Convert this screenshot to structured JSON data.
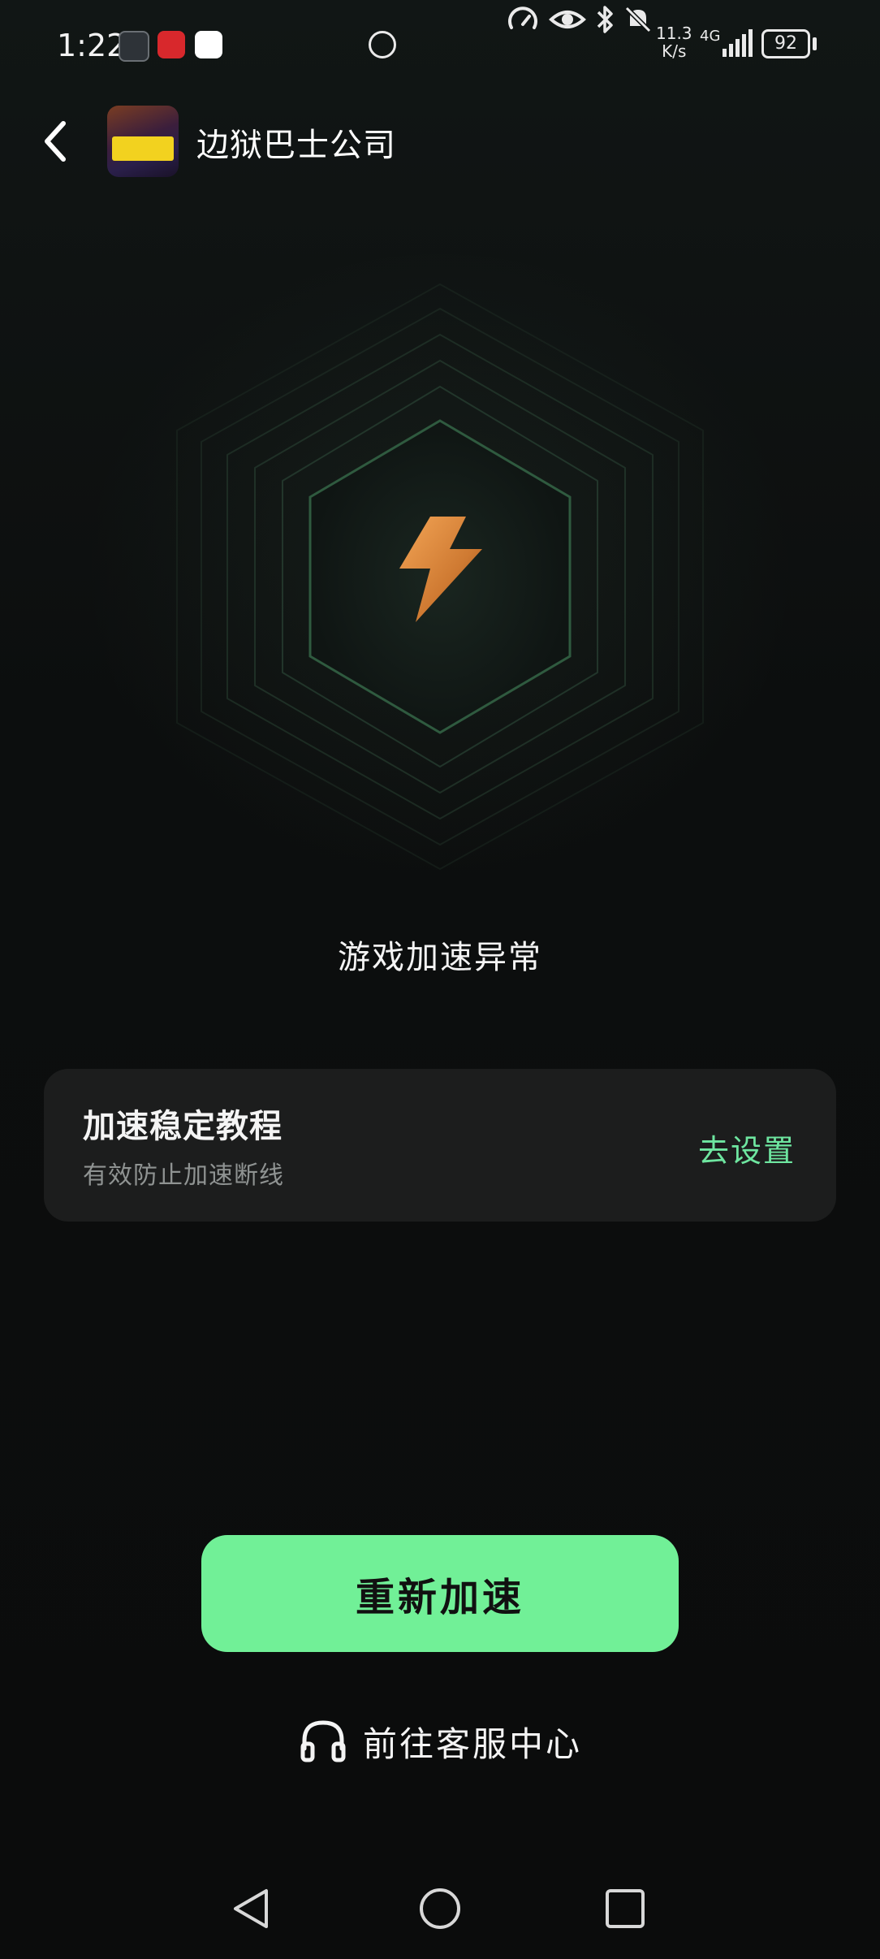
{
  "status_bar": {
    "time": "1:22",
    "net_speed_value": "11.3",
    "net_speed_unit": "K/s",
    "network": "4G",
    "battery": "92",
    "icons": [
      "app-notification-icon",
      "huawei-icon",
      "browser-icon",
      "data-saver-icon",
      "speedometer-icon",
      "eye-icon",
      "bluetooth-icon",
      "mute-icon",
      "signal-icon",
      "battery-icon"
    ]
  },
  "header": {
    "back_icon": "chevron-left-icon",
    "game_title": "边狱巴士公司"
  },
  "status_message": "游戏加速异常",
  "tutorial_card": {
    "title": "加速稳定教程",
    "subtitle": "有效防止加速断线",
    "action_label": "去设置"
  },
  "retry_button_label": "重新加速",
  "support_link": {
    "icon": "headset-icon",
    "label": "前往客服中心"
  },
  "colors": {
    "accent_green": "#71f097",
    "action_green": "#6ee6a0",
    "bolt_orange": "#d98a3c",
    "card_bg": "#1c1d1d"
  },
  "nav_bar": {
    "icons": [
      "nav-back-icon",
      "nav-home-icon",
      "nav-recent-icon"
    ]
  }
}
